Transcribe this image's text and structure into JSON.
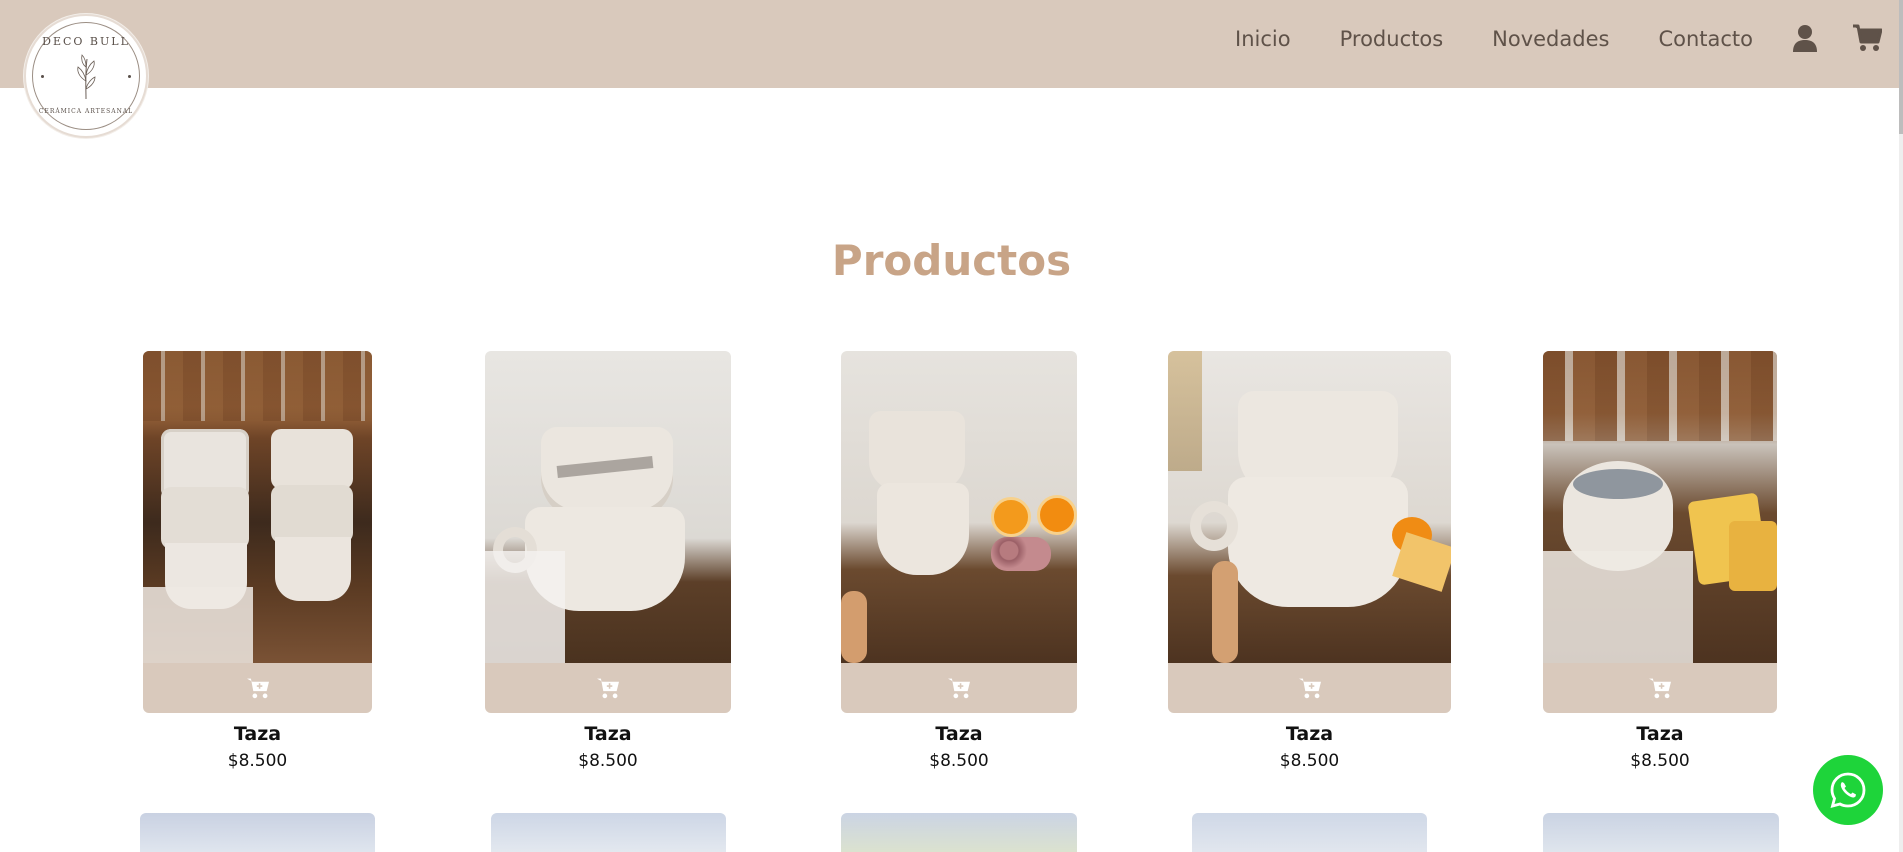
{
  "brand": {
    "logo_top": "DECO BULL",
    "logo_bottom": "CERÁMICA ARTESANAL"
  },
  "nav": {
    "items": [
      {
        "label": "Inicio"
      },
      {
        "label": "Productos"
      },
      {
        "label": "Novedades"
      },
      {
        "label": "Contacto"
      }
    ],
    "user_icon": "user-icon",
    "cart_icon": "cart-icon"
  },
  "main": {
    "title": "Productos",
    "products": [
      {
        "name": "Taza",
        "price": "$8.500"
      },
      {
        "name": "Taza",
        "price": "$8.500"
      },
      {
        "name": "Taza",
        "price": "$8.500"
      },
      {
        "name": "Taza",
        "price": "$8.500"
      },
      {
        "name": "Taza",
        "price": "$8.500"
      }
    ]
  },
  "floating": {
    "whatsapp_icon": "whatsapp-icon"
  },
  "colors": {
    "header_bg": "#d9c9bc",
    "title": "#c8a487",
    "nav_text": "#5f5249",
    "whatsapp": "#1ed43a"
  }
}
